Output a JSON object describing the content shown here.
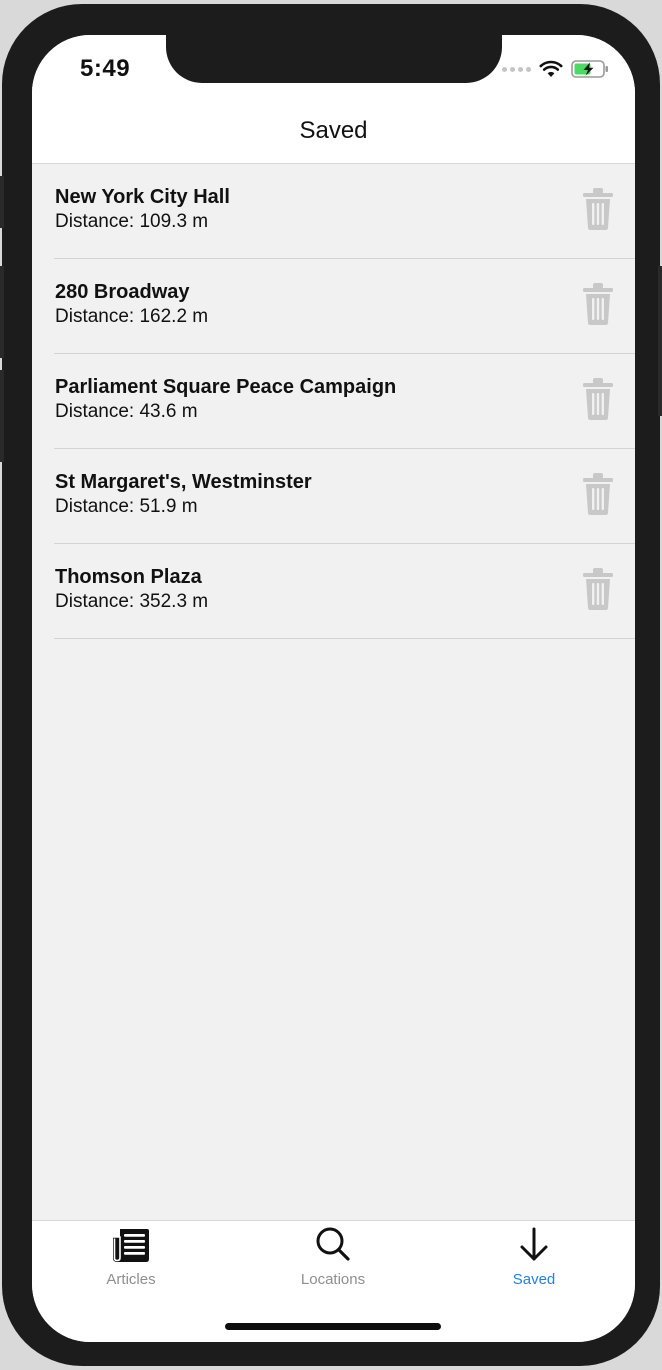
{
  "status_bar": {
    "time": "5:49"
  },
  "nav": {
    "title": "Saved"
  },
  "saved_places": [
    {
      "name": "New York City Hall",
      "distance": "Distance: 109.3 m"
    },
    {
      "name": "280 Broadway",
      "distance": "Distance: 162.2 m"
    },
    {
      "name": "Parliament Square Peace Campaign",
      "distance": "Distance: 43.6 m"
    },
    {
      "name": "St Margaret's, Westminster",
      "distance": "Distance: 51.9 m"
    },
    {
      "name": "Thomson Plaza",
      "distance": "Distance: 352.3 m"
    }
  ],
  "tabs": [
    {
      "label": "Articles",
      "icon": "newspaper-icon",
      "active": false
    },
    {
      "label": "Locations",
      "icon": "search-icon",
      "active": false
    },
    {
      "label": "Saved",
      "icon": "arrow-down-icon",
      "active": true
    }
  ],
  "colors": {
    "accent": "#1a82f0",
    "inactive_tab": "#8e8e93",
    "trash_icon": "#c8c8c8",
    "battery_fill": "#4cd964"
  }
}
